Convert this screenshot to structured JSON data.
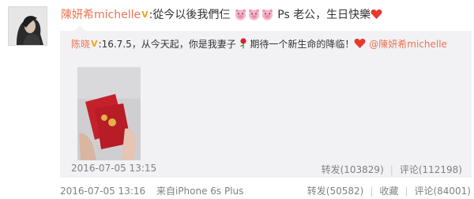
{
  "post": {
    "author": "陳妍希michelle",
    "colon": ":",
    "text_part1": "從今以後我們仨",
    "text_part2": " Ps 老公，生日快樂",
    "emoji_pig": "pig-emoji",
    "emoji_heart": "heart-emoji",
    "timestamp": "2016-07-05 13:16",
    "source": "来自iPhone 6s Plus",
    "actions": {
      "repost": "转发(50582)",
      "favorite": "收藏",
      "comment": "评论(84001)"
    }
  },
  "repost": {
    "author": "陈晓",
    "colon": ":",
    "text_part1": "16.7.5，从今天起，你是我妻子",
    "text_part2": "期待一个新生命的降临！",
    "mention": "@陳妍希michelle",
    "emoji_rose": "rose-emoji",
    "emoji_heart": "heart-emoji",
    "timestamp": "2016-07-05 13:15",
    "actions": {
      "repost": "转发(103829)",
      "comment": "评论(112198)"
    }
  },
  "colors": {
    "username": "#eb7350",
    "meta": "#808080",
    "repost_bg": "#f2f2f5",
    "verified": "#f3a41d"
  }
}
